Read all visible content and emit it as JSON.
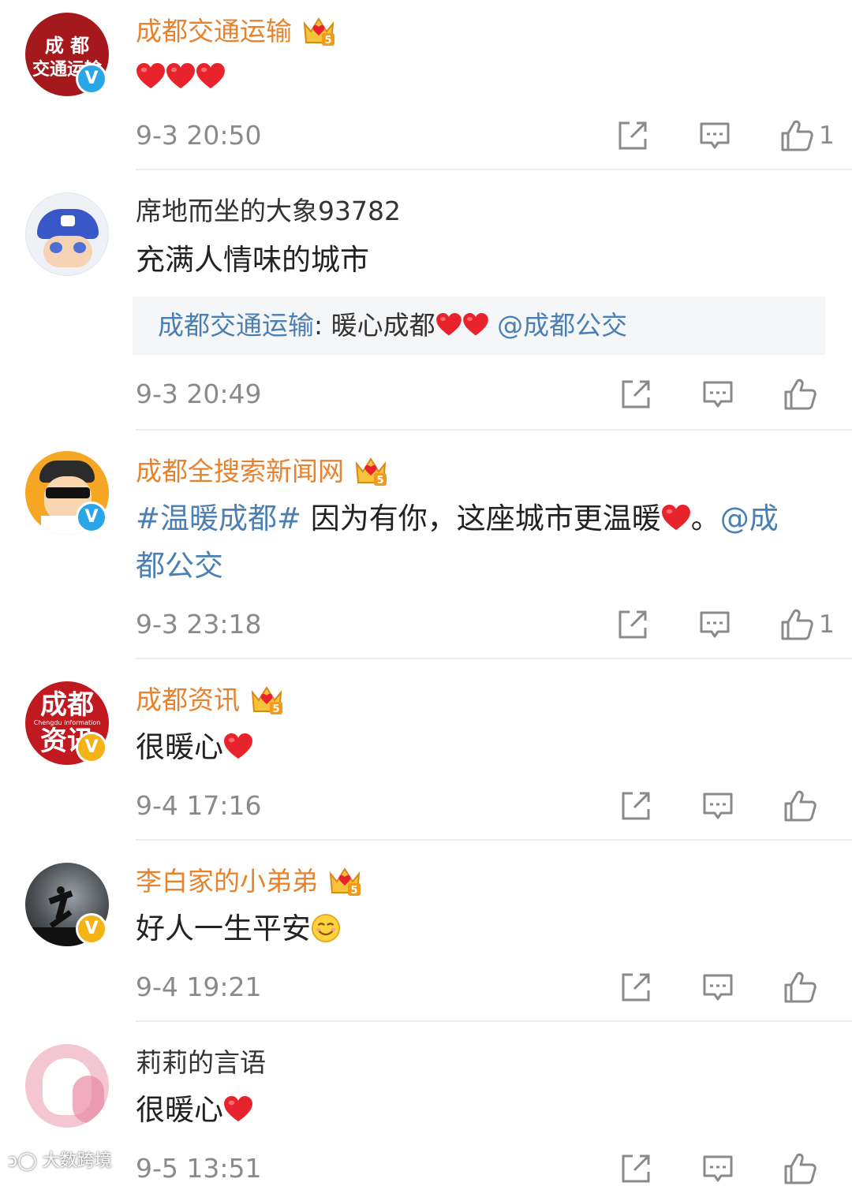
{
  "comments": [
    {
      "name": "成都交通运输",
      "avatar_text_1": "成 都",
      "avatar_text_2": "交通运输",
      "text": "",
      "time": "9-3 20:50",
      "likes": "1"
    },
    {
      "name": "席地而坐的大象93782",
      "text": "充满人情味的城市",
      "quote_name": "成都交通运输",
      "quote_sep": ": ",
      "quote_text": "暖心成都",
      "quote_at": "@成都公交",
      "time": "9-3 20:49",
      "likes": ""
    },
    {
      "name": "成都全搜索新闻网",
      "tag": "#温暖成都#",
      "text": " 因为有你，这座城市更温暖",
      "text_end": "。",
      "at_1": "@成",
      "at_2": "都公交",
      "time": "9-3 23:18",
      "likes": "1"
    },
    {
      "name": "成都资讯",
      "avatar_text_1": "成都",
      "avatar_text_2": "资讯",
      "avatar_text_small": "Chengdu information",
      "text": "很暖心",
      "time": "9-4 17:16",
      "likes": ""
    },
    {
      "name": "李白家的小弟弟",
      "text": "好人一生平安",
      "time": "9-4 19:21",
      "likes": ""
    },
    {
      "name": "莉莉的言语",
      "text": "很暖心",
      "time": "9-5 13:51",
      "likes": ""
    }
  ],
  "icons": {
    "verified": "V",
    "crown_level": "5",
    "share": "share-icon",
    "reply": "comment-icon",
    "like": "thumb-up-icon"
  },
  "watermark": "大数跨境",
  "colors": {
    "vip_name": "#e8822c",
    "link": "#4c7fb2",
    "heart": "#e8232c",
    "verified_blue": "#2aa6e8",
    "verified_gold": "#f4b316",
    "meta": "#8a8a8a"
  }
}
